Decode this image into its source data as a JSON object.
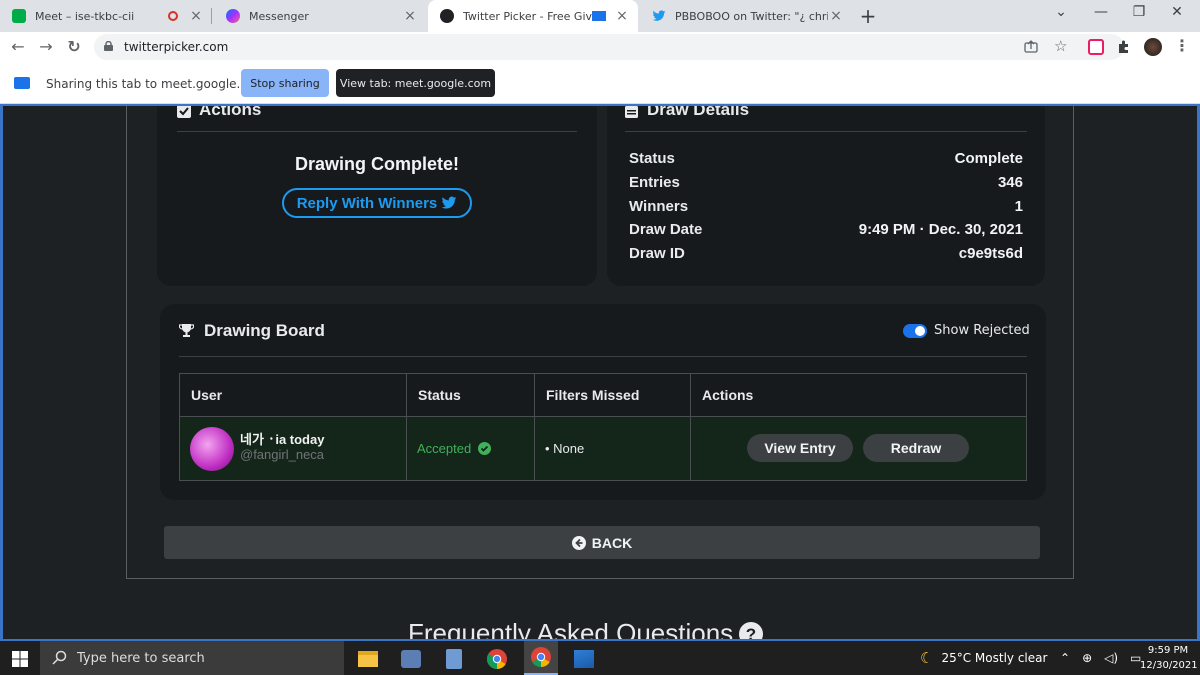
{
  "browser": {
    "tabs": [
      {
        "title": "Meet – ise-tkbc-cii",
        "icon_color": "#00ac47",
        "recording": true
      },
      {
        "title": "Messenger",
        "icon_color": "#a033ff"
      },
      {
        "title": "Twitter Picker - Free Giveawa",
        "icon_color": "#202124",
        "active": true
      },
      {
        "title": "PBBOBOO on Twitter: \"¿ christm",
        "icon_color": "#1d9bf0"
      }
    ],
    "new_tab": "+",
    "window_controls": {
      "chevron": "⌄",
      "minimize": "—",
      "restore": "❐",
      "close": "✕"
    },
    "url": "twitterpicker.com",
    "nav": {
      "back": "←",
      "forward": "→",
      "reload": "↻"
    }
  },
  "sharing_bar": {
    "text": "Sharing this tab to meet.google.com",
    "stop_label": "Stop sharing",
    "view_label": "View tab: meet.google.com"
  },
  "actions_panel": {
    "title": "Actions",
    "status_text": "Drawing Complete!",
    "reply_label": "Reply With Winners"
  },
  "draw_details": {
    "title": "Draw Details",
    "rows": [
      {
        "label": "Status",
        "value": "Complete"
      },
      {
        "label": "Entries",
        "value": "346"
      },
      {
        "label": "Winners",
        "value": "1"
      },
      {
        "label": "Draw Date",
        "value": "9:49 PM · Dec. 30, 2021"
      },
      {
        "label": "Draw ID",
        "value": "c9e9ts6d"
      }
    ]
  },
  "drawing_board": {
    "title": "Drawing Board",
    "toggle_label": "Show Rejected",
    "toggle_on": true,
    "columns": [
      "User",
      "Status",
      "Filters Missed",
      "Actions"
    ],
    "rows": [
      {
        "user_name": "네가 ᛫ia today",
        "user_handle": "@fangirl_neca",
        "status": "Accepted",
        "filters_missed": "• None",
        "view_label": "View Entry",
        "redraw_label": "Redraw"
      }
    ]
  },
  "back_label": "BACK",
  "faq_title": "Frequently Asked Questions",
  "taskbar": {
    "search_placeholder": "Type here to search",
    "weather": "25°C  Mostly clear",
    "time": "9:59 PM",
    "date": "12/30/2021"
  },
  "colors": {
    "twitter_blue": "#1d9bf0",
    "accepted_green": "#3fb15a",
    "panel_bg": "#171a1c",
    "page_bg": "#1e2124",
    "share_blue": "#8ab4f8"
  }
}
